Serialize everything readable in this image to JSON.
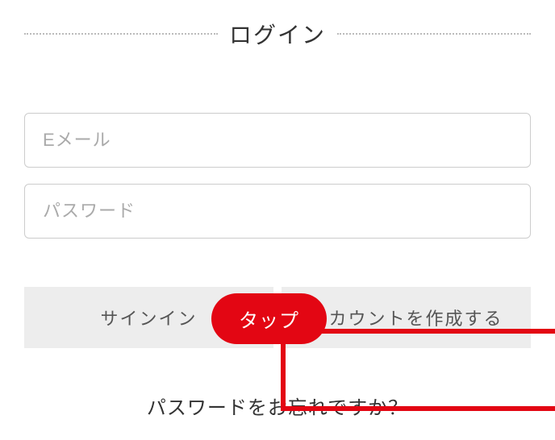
{
  "title": "ログイン",
  "email": {
    "placeholder": "Eメール",
    "value": ""
  },
  "password": {
    "placeholder": "パスワード",
    "value": ""
  },
  "buttons": {
    "signin": "サインイン",
    "create": "アカウントを作成する"
  },
  "annotation": {
    "tap": "タップ"
  },
  "forgot": "パスワードをお忘れですか？"
}
